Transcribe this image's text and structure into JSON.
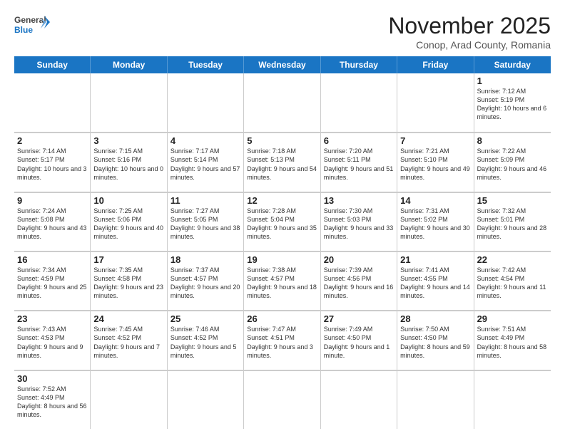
{
  "header": {
    "logo_general": "General",
    "logo_blue": "Blue",
    "month_title": "November 2025",
    "location": "Conop, Arad County, Romania"
  },
  "weekdays": [
    "Sunday",
    "Monday",
    "Tuesday",
    "Wednesday",
    "Thursday",
    "Friday",
    "Saturday"
  ],
  "weeks": [
    [
      {
        "day": "",
        "info": ""
      },
      {
        "day": "",
        "info": ""
      },
      {
        "day": "",
        "info": ""
      },
      {
        "day": "",
        "info": ""
      },
      {
        "day": "",
        "info": ""
      },
      {
        "day": "",
        "info": ""
      },
      {
        "day": "1",
        "info": "Sunrise: 7:12 AM\nSunset: 5:19 PM\nDaylight: 10 hours\nand 6 minutes."
      }
    ],
    [
      {
        "day": "2",
        "info": "Sunrise: 7:14 AM\nSunset: 5:17 PM\nDaylight: 10 hours\nand 3 minutes."
      },
      {
        "day": "3",
        "info": "Sunrise: 7:15 AM\nSunset: 5:16 PM\nDaylight: 10 hours\nand 0 minutes."
      },
      {
        "day": "4",
        "info": "Sunrise: 7:17 AM\nSunset: 5:14 PM\nDaylight: 9 hours\nand 57 minutes."
      },
      {
        "day": "5",
        "info": "Sunrise: 7:18 AM\nSunset: 5:13 PM\nDaylight: 9 hours\nand 54 minutes."
      },
      {
        "day": "6",
        "info": "Sunrise: 7:20 AM\nSunset: 5:11 PM\nDaylight: 9 hours\nand 51 minutes."
      },
      {
        "day": "7",
        "info": "Sunrise: 7:21 AM\nSunset: 5:10 PM\nDaylight: 9 hours\nand 49 minutes."
      },
      {
        "day": "8",
        "info": "Sunrise: 7:22 AM\nSunset: 5:09 PM\nDaylight: 9 hours\nand 46 minutes."
      }
    ],
    [
      {
        "day": "9",
        "info": "Sunrise: 7:24 AM\nSunset: 5:08 PM\nDaylight: 9 hours\nand 43 minutes."
      },
      {
        "day": "10",
        "info": "Sunrise: 7:25 AM\nSunset: 5:06 PM\nDaylight: 9 hours\nand 40 minutes."
      },
      {
        "day": "11",
        "info": "Sunrise: 7:27 AM\nSunset: 5:05 PM\nDaylight: 9 hours\nand 38 minutes."
      },
      {
        "day": "12",
        "info": "Sunrise: 7:28 AM\nSunset: 5:04 PM\nDaylight: 9 hours\nand 35 minutes."
      },
      {
        "day": "13",
        "info": "Sunrise: 7:30 AM\nSunset: 5:03 PM\nDaylight: 9 hours\nand 33 minutes."
      },
      {
        "day": "14",
        "info": "Sunrise: 7:31 AM\nSunset: 5:02 PM\nDaylight: 9 hours\nand 30 minutes."
      },
      {
        "day": "15",
        "info": "Sunrise: 7:32 AM\nSunset: 5:01 PM\nDaylight: 9 hours\nand 28 minutes."
      }
    ],
    [
      {
        "day": "16",
        "info": "Sunrise: 7:34 AM\nSunset: 4:59 PM\nDaylight: 9 hours\nand 25 minutes."
      },
      {
        "day": "17",
        "info": "Sunrise: 7:35 AM\nSunset: 4:58 PM\nDaylight: 9 hours\nand 23 minutes."
      },
      {
        "day": "18",
        "info": "Sunrise: 7:37 AM\nSunset: 4:57 PM\nDaylight: 9 hours\nand 20 minutes."
      },
      {
        "day": "19",
        "info": "Sunrise: 7:38 AM\nSunset: 4:57 PM\nDaylight: 9 hours\nand 18 minutes."
      },
      {
        "day": "20",
        "info": "Sunrise: 7:39 AM\nSunset: 4:56 PM\nDaylight: 9 hours\nand 16 minutes."
      },
      {
        "day": "21",
        "info": "Sunrise: 7:41 AM\nSunset: 4:55 PM\nDaylight: 9 hours\nand 14 minutes."
      },
      {
        "day": "22",
        "info": "Sunrise: 7:42 AM\nSunset: 4:54 PM\nDaylight: 9 hours\nand 11 minutes."
      }
    ],
    [
      {
        "day": "23",
        "info": "Sunrise: 7:43 AM\nSunset: 4:53 PM\nDaylight: 9 hours\nand 9 minutes."
      },
      {
        "day": "24",
        "info": "Sunrise: 7:45 AM\nSunset: 4:52 PM\nDaylight: 9 hours\nand 7 minutes."
      },
      {
        "day": "25",
        "info": "Sunrise: 7:46 AM\nSunset: 4:52 PM\nDaylight: 9 hours\nand 5 minutes."
      },
      {
        "day": "26",
        "info": "Sunrise: 7:47 AM\nSunset: 4:51 PM\nDaylight: 9 hours\nand 3 minutes."
      },
      {
        "day": "27",
        "info": "Sunrise: 7:49 AM\nSunset: 4:50 PM\nDaylight: 9 hours\nand 1 minute."
      },
      {
        "day": "28",
        "info": "Sunrise: 7:50 AM\nSunset: 4:50 PM\nDaylight: 8 hours\nand 59 minutes."
      },
      {
        "day": "29",
        "info": "Sunrise: 7:51 AM\nSunset: 4:49 PM\nDaylight: 8 hours\nand 58 minutes."
      }
    ],
    [
      {
        "day": "30",
        "info": "Sunrise: 7:52 AM\nSunset: 4:49 PM\nDaylight: 8 hours\nand 56 minutes."
      },
      {
        "day": "",
        "info": ""
      },
      {
        "day": "",
        "info": ""
      },
      {
        "day": "",
        "info": ""
      },
      {
        "day": "",
        "info": ""
      },
      {
        "day": "",
        "info": ""
      },
      {
        "day": "",
        "info": ""
      }
    ]
  ]
}
